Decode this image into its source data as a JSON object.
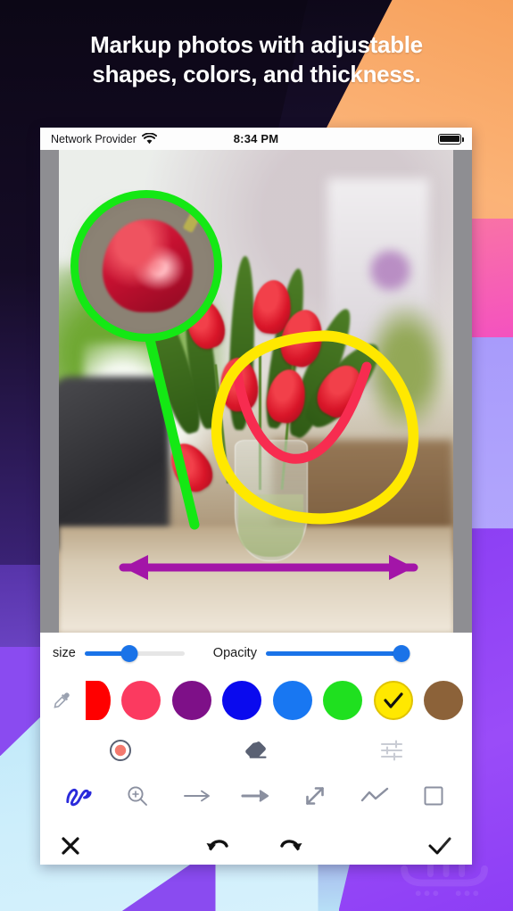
{
  "headline": {
    "line1": "Markup photos with adjustable",
    "line2": "shapes, colors, and thickness."
  },
  "phone": {
    "status_bar": {
      "carrier": "Network Provider",
      "wifi_icon": "wifi-icon",
      "time": "8:34 PM",
      "battery_icon": "battery-full-icon"
    }
  },
  "photo": {
    "description": "Red tulips in a glass vase on a table by a window",
    "annotations": [
      {
        "type": "magnifier-loupe",
        "color": "#14E814",
        "name": "green-loupe-annotation"
      },
      {
        "type": "arc",
        "color": "#F72C50",
        "name": "red-arc-annotation"
      },
      {
        "type": "lasso",
        "color": "#FFE800",
        "name": "yellow-lasso-annotation"
      },
      {
        "type": "double-arrow",
        "color": "#A315A8",
        "name": "purple-double-arrow-annotation"
      }
    ]
  },
  "toolbar": {
    "size_label": "size",
    "size_value": 45,
    "opacity_label": "Opacity",
    "opacity_value": 100,
    "slider_color": "#1A73E8",
    "eyedropper_icon": "eyedropper-icon",
    "colors": [
      {
        "name": "red",
        "hex": "#FF0000",
        "selected": false,
        "clipped": true
      },
      {
        "name": "pink",
        "hex": "#FB3A60",
        "selected": false,
        "clipped": false
      },
      {
        "name": "purple",
        "hex": "#7E1088",
        "selected": false,
        "clipped": false
      },
      {
        "name": "blue",
        "hex": "#0A0AEE",
        "selected": false,
        "clipped": false
      },
      {
        "name": "dodgerblue",
        "hex": "#1877F2",
        "selected": false,
        "clipped": false
      },
      {
        "name": "green",
        "hex": "#1FE01F",
        "selected": false,
        "clipped": false
      },
      {
        "name": "yellow",
        "hex": "#FFE800",
        "selected": true,
        "clipped": false
      },
      {
        "name": "brown",
        "hex": "#8C6239",
        "selected": false,
        "clipped": false
      }
    ],
    "tools": [
      {
        "name": "brush-preview-icon",
        "label": "brush-size-preview",
        "active": false
      },
      {
        "name": "eraser-icon",
        "label": "eraser",
        "active": false
      },
      {
        "name": "adjustments-icon",
        "label": "settings",
        "active": false
      }
    ],
    "shapes": [
      {
        "name": "freehand-icon",
        "label": "freehand",
        "active": true
      },
      {
        "name": "magnifier-icon",
        "label": "magnifier",
        "active": false
      },
      {
        "name": "arrow-thin-icon",
        "label": "thin-arrow",
        "active": false
      },
      {
        "name": "arrow-thick-icon",
        "label": "thick-arrow",
        "active": false
      },
      {
        "name": "double-arrow-icon",
        "label": "double-arrow",
        "active": false
      },
      {
        "name": "polyline-icon",
        "label": "polyline",
        "active": false
      },
      {
        "name": "rectangle-icon",
        "label": "rectangle",
        "active": false
      }
    ],
    "actions": [
      {
        "name": "close-icon",
        "label": "Close"
      },
      {
        "name": "undo-icon",
        "label": "Undo"
      },
      {
        "name": "redo-icon",
        "label": "Redo"
      },
      {
        "name": "check-icon",
        "label": "Done"
      }
    ],
    "active_tool_color": "#2A2ADB"
  },
  "watermark": {
    "text": "سافه"
  }
}
